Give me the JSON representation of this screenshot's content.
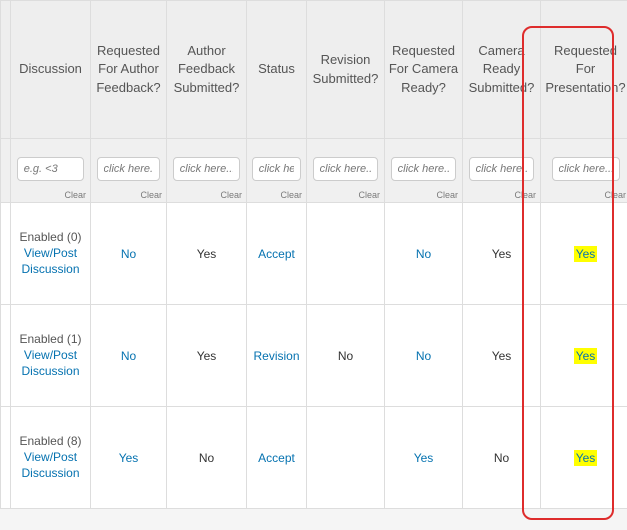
{
  "headers": {
    "discussion": "Discussion",
    "req_author_fb": "Requested For Author Feedback?",
    "author_fb_sub": "Author Feedback Submitted?",
    "status": "Status",
    "rev_sub": "Revision Submitted?",
    "req_camera": "Requested For Camera Ready?",
    "camera_sub": "Camera Ready Submitted?",
    "req_pres": "Requested For Presentation?"
  },
  "filters": {
    "placeholder_eg": "e.g. <3",
    "placeholder_click": "click here...",
    "clear_label": "Clear"
  },
  "rows": [
    {
      "enabled": "Enabled (0)",
      "view_post": "View/Post Discussion",
      "req_author_fb": "No",
      "author_fb_sub": "Yes",
      "status": "Accept",
      "rev_sub": "",
      "req_camera": "No",
      "camera_sub": "Yes",
      "req_pres": "Yes"
    },
    {
      "enabled": "Enabled (1)",
      "view_post": "View/Post Discussion",
      "req_author_fb": "No",
      "author_fb_sub": "Yes",
      "status": "Revision",
      "rev_sub": "No",
      "req_camera": "No",
      "camera_sub": "Yes",
      "req_pres": "Yes"
    },
    {
      "enabled": "Enabled (8)",
      "view_post": "View/Post Discussion",
      "req_author_fb": "Yes",
      "author_fb_sub": "No",
      "status": "Accept",
      "rev_sub": "",
      "req_camera": "Yes",
      "camera_sub": "No",
      "req_pres": "Yes"
    }
  ]
}
